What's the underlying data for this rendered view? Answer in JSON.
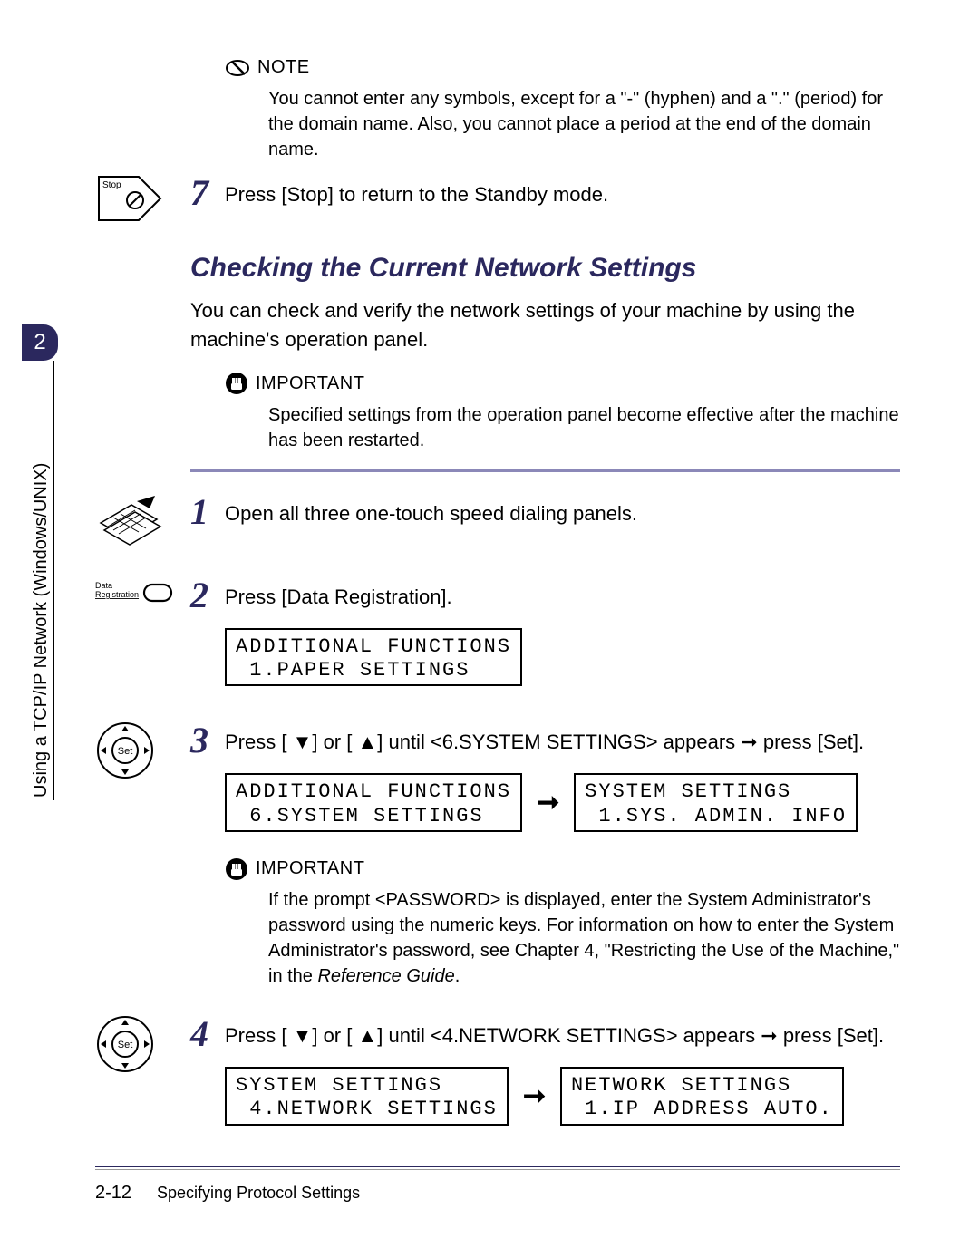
{
  "sidebar": {
    "chapter_num": "2",
    "chapter_text": "Using a TCP/IP Network (Windows/UNIX)"
  },
  "note": {
    "label": "NOTE",
    "body": "You cannot enter any symbols, except for a \"-\" (hyphen) and a \".\" (period) for the domain name. Also, you cannot place a period at the end of the domain name."
  },
  "step7": {
    "num": "7",
    "text": "Press [Stop] to return to the Standby mode."
  },
  "section": {
    "heading": "Checking the Current Network Settings",
    "intro": "You can check and verify the network settings of your machine by using the machine's operation panel."
  },
  "important1": {
    "label": "IMPORTANT",
    "body": "Specified settings from the operation panel become effective after the machine has been restarted."
  },
  "step1": {
    "num": "1",
    "text": "Open all three one-touch speed dialing panels."
  },
  "step2": {
    "num": "2",
    "text": "Press [Data Registration].",
    "lcd_line1": "ADDITIONAL FUNCTIONS",
    "lcd_line2": " 1.PAPER SETTINGS"
  },
  "step3": {
    "num": "3",
    "text_a": "Press [ ▼] or [ ▲] until <6.SYSTEM SETTINGS> appears   ➞   press [Set].",
    "lcdA_line1": "ADDITIONAL FUNCTIONS",
    "lcdA_line2": " 6.SYSTEM SETTINGS",
    "lcdB_line1": "SYSTEM SETTINGS",
    "lcdB_line2": " 1.SYS. ADMIN. INFO"
  },
  "important2": {
    "label": "IMPORTANT",
    "body_a": "If the prompt <PASSWORD> is displayed, enter the System Administrator's password using the numeric keys. For information on how to enter the System Administrator's password, see Chapter 4, \"Restricting the Use of the Machine,\" in the ",
    "body_ref": "Reference Guide",
    "body_b": "."
  },
  "step4": {
    "num": "4",
    "text_a": "Press [ ▼] or [ ▲] until <4.NETWORK SETTINGS> appears   ➞   press [Set].",
    "lcdA_line1": "SYSTEM SETTINGS",
    "lcdA_line2": " 4.NETWORK SETTINGS",
    "lcdB_line1": "NETWORK SETTINGS",
    "lcdB_line2": " 1.IP ADDRESS AUTO."
  },
  "arrows": {
    "big": "➞"
  },
  "labels": {
    "stop": "Stop",
    "data_reg_a": "Data",
    "data_reg_b": "Registration",
    "set": "Set"
  },
  "footer": {
    "page": "2-12",
    "title": "Specifying Protocol Settings"
  }
}
